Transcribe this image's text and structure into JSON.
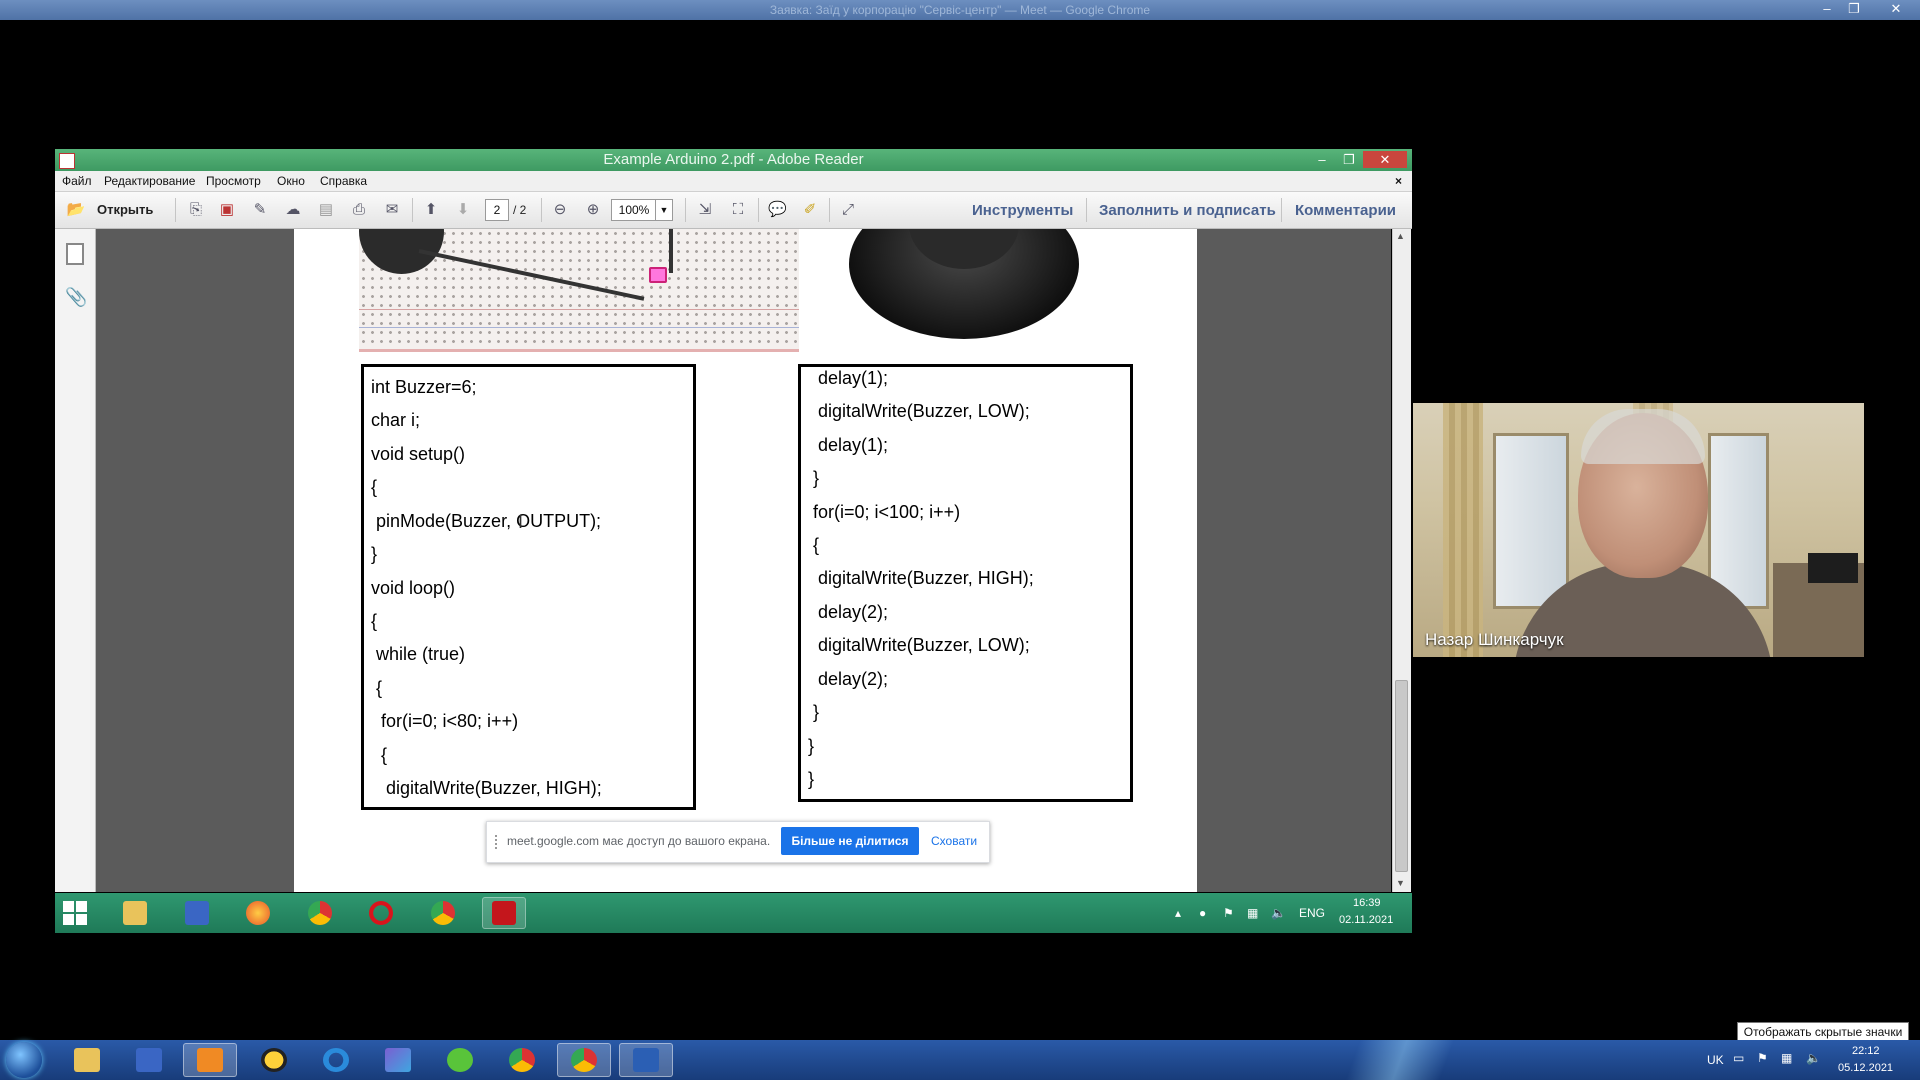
{
  "outer_window": {
    "title": "Заявка: Заїд у корпорацію \"Сервіс-центр\" — Meet — Google Chrome",
    "controls": [
      "–",
      "❐",
      "✕"
    ]
  },
  "adobe": {
    "title": "Example Arduino 2.pdf - Adobe Reader",
    "menu": [
      "Файл",
      "Редактирование",
      "Просмотр",
      "Окно",
      "Справка"
    ],
    "menu_close": "×",
    "toolbar": {
      "open_label": "Открыть",
      "page_current": "2",
      "page_total": "/ 2",
      "zoom": "100%",
      "tools_label": "Инструменты",
      "fill_sign_label": "Заполнить и подписать",
      "comments_label": "Комментарии"
    }
  },
  "pdf": {
    "code_left": [
      "int Buzzer=6;",
      "char i;",
      "void setup()",
      "{",
      " pinMode(Buzzer, OUTPUT);",
      "}",
      "void loop()",
      "{",
      " while (true)",
      " {",
      "  for(i=0; i<80; i++)",
      "  {",
      "   digitalWrite(Buzzer, HIGH);"
    ],
    "code_right": [
      "  delay(1);",
      "  digitalWrite(Buzzer, LOW);",
      "  delay(1);",
      " }",
      " for(i=0; i<100; i++)",
      " {",
      "  digitalWrite(Buzzer, HIGH);",
      "  delay(2);",
      "  digitalWrite(Buzzer, LOW);",
      "  delay(2);",
      " }",
      "}",
      "}"
    ]
  },
  "meet_banner": {
    "text": "meet.google.com має доступ до вашого екрана.",
    "stop_label": "Більше не ділитися",
    "hide_label": "Сховати"
  },
  "inner_taskbar": {
    "lang": "ENG",
    "time": "16:39",
    "date": "02.11.2021"
  },
  "video": {
    "participant_name": "Назар Шинкарчук"
  },
  "tooltip": "Отображать скрытые значки",
  "outer_taskbar": {
    "lang": "UK",
    "time": "22:12",
    "date": "05.12.2021"
  }
}
